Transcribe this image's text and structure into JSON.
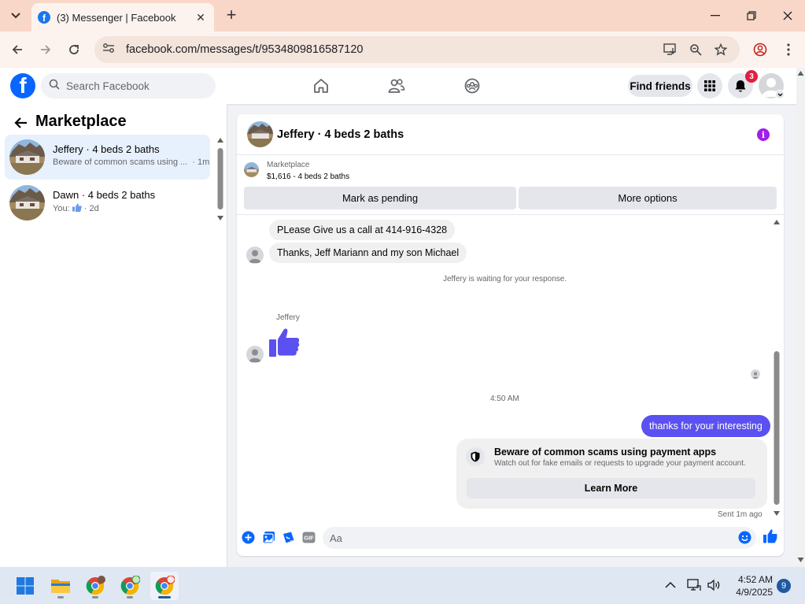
{
  "browser": {
    "tab_title": "(3) Messenger | Facebook",
    "url": "facebook.com/messages/t/9534809816587120"
  },
  "fb_header": {
    "logo": "f",
    "search_placeholder": "Search Facebook",
    "find_friends_label": "Find friends",
    "notification_count": "3"
  },
  "marketplace": {
    "title": "Marketplace",
    "conversations": [
      {
        "name": "Jeffery · 4 beds 2 baths",
        "snippet": "Beware of common scams using ...",
        "time": "· 1m",
        "active": true
      },
      {
        "name": "Dawn · 4 beds 2 baths",
        "snippet_prefix": "You:",
        "time": "· 2d",
        "active": false
      }
    ]
  },
  "chat": {
    "title": "Jeffery · 4 beds 2 baths",
    "listing": {
      "category": "Marketplace",
      "price_line": "$1,616 - 4 beds 2 baths",
      "mark_pending_label": "Mark as pending",
      "more_options_label": "More options"
    },
    "messages": {
      "msg1": "PLease Give us a call at 414-916-4328",
      "msg2": "Thanks, Jeff Mariann and my son Michael",
      "waiting_notice": "Jeffery is waiting for your response.",
      "sender_name": "Jeffery",
      "timestamp": "4:50 AM",
      "outgoing": "thanks for your interesting",
      "scam_title": "Beware of common scams using payment apps",
      "scam_desc": "Watch out for fake emails or requests to upgrade your payment account.",
      "learn_more_label": "Learn More",
      "sent_status": "Sent 1m ago"
    },
    "composer_placeholder": "Aa"
  },
  "taskbar": {
    "time": "4:52 AM",
    "date": "4/9/2025",
    "notification_count": "9"
  },
  "colors": {
    "facebook_blue": "#0866ff",
    "outgoing_bubble": "#5b50f0",
    "info_icon": "#a31ee6",
    "notification_red": "#e41e3f"
  }
}
